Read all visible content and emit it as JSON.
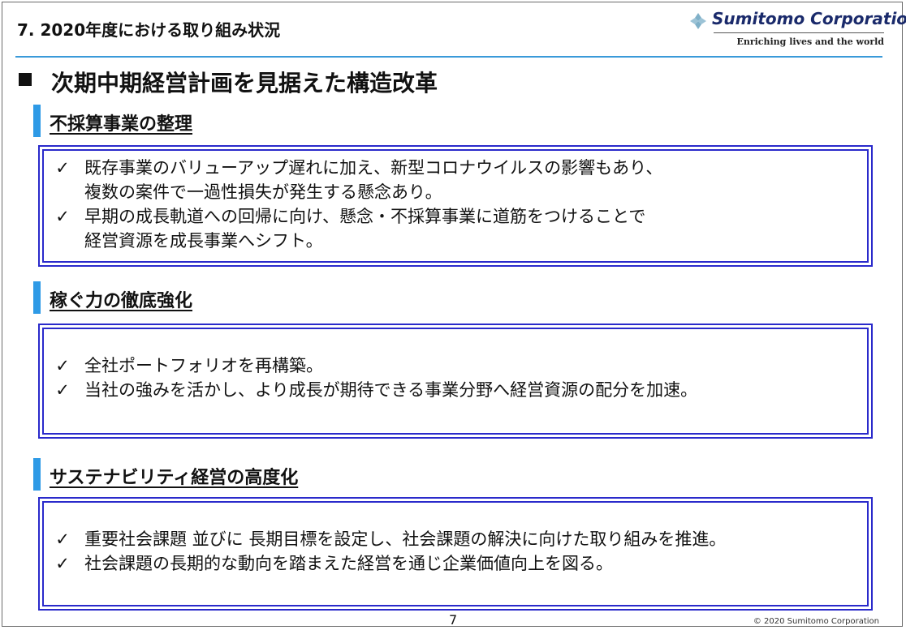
{
  "header": {
    "title": "7. 2020年度における取り組み状況",
    "logo_name": "Sumitomo Corporation",
    "logo_tagline": "Enriching lives and the world"
  },
  "main_title": "次期中期経営計画を見据えた構造改革",
  "sections": [
    {
      "heading": "不採算事業の整理",
      "bullets": [
        {
          "lines": [
            "既存事業のバリューアップ遅れに加え、新型コロナウイルスの影響もあり、",
            "複数の案件で一過性損失が発生する懸念あり。"
          ]
        },
        {
          "lines": [
            "早期の成長軌道への回帰に向け、懸念・不採算事業に道筋をつけることで",
            "経営資源を成長事業へシフト。"
          ]
        }
      ]
    },
    {
      "heading": "稼ぐ力の徹底強化",
      "bullets": [
        {
          "lines": [
            "全社ポートフォリオを再構築。"
          ]
        },
        {
          "lines": [
            "当社の強みを活かし、より成長が期待できる事業分野へ経営資源の配分を加速。"
          ]
        }
      ]
    },
    {
      "heading": "サステナビリティ経営の高度化",
      "bullets": [
        {
          "lines": [
            "重要社会課題 並びに 長期目標を設定し、社会課題の解決に向けた取り組みを推進。"
          ]
        },
        {
          "lines": [
            "社会課題の長期的な動向を踏まえた経営を通じ企業価値向上を図る。"
          ]
        }
      ]
    }
  ],
  "check_symbol": "✓",
  "footer": {
    "page_number": "7",
    "copyright": "© 2020 Sumitomo Corporation"
  },
  "colors": {
    "accent_blue": "#2e9ae6",
    "box_border": "#2a2acb",
    "header_rule": "#3a9ad9"
  }
}
